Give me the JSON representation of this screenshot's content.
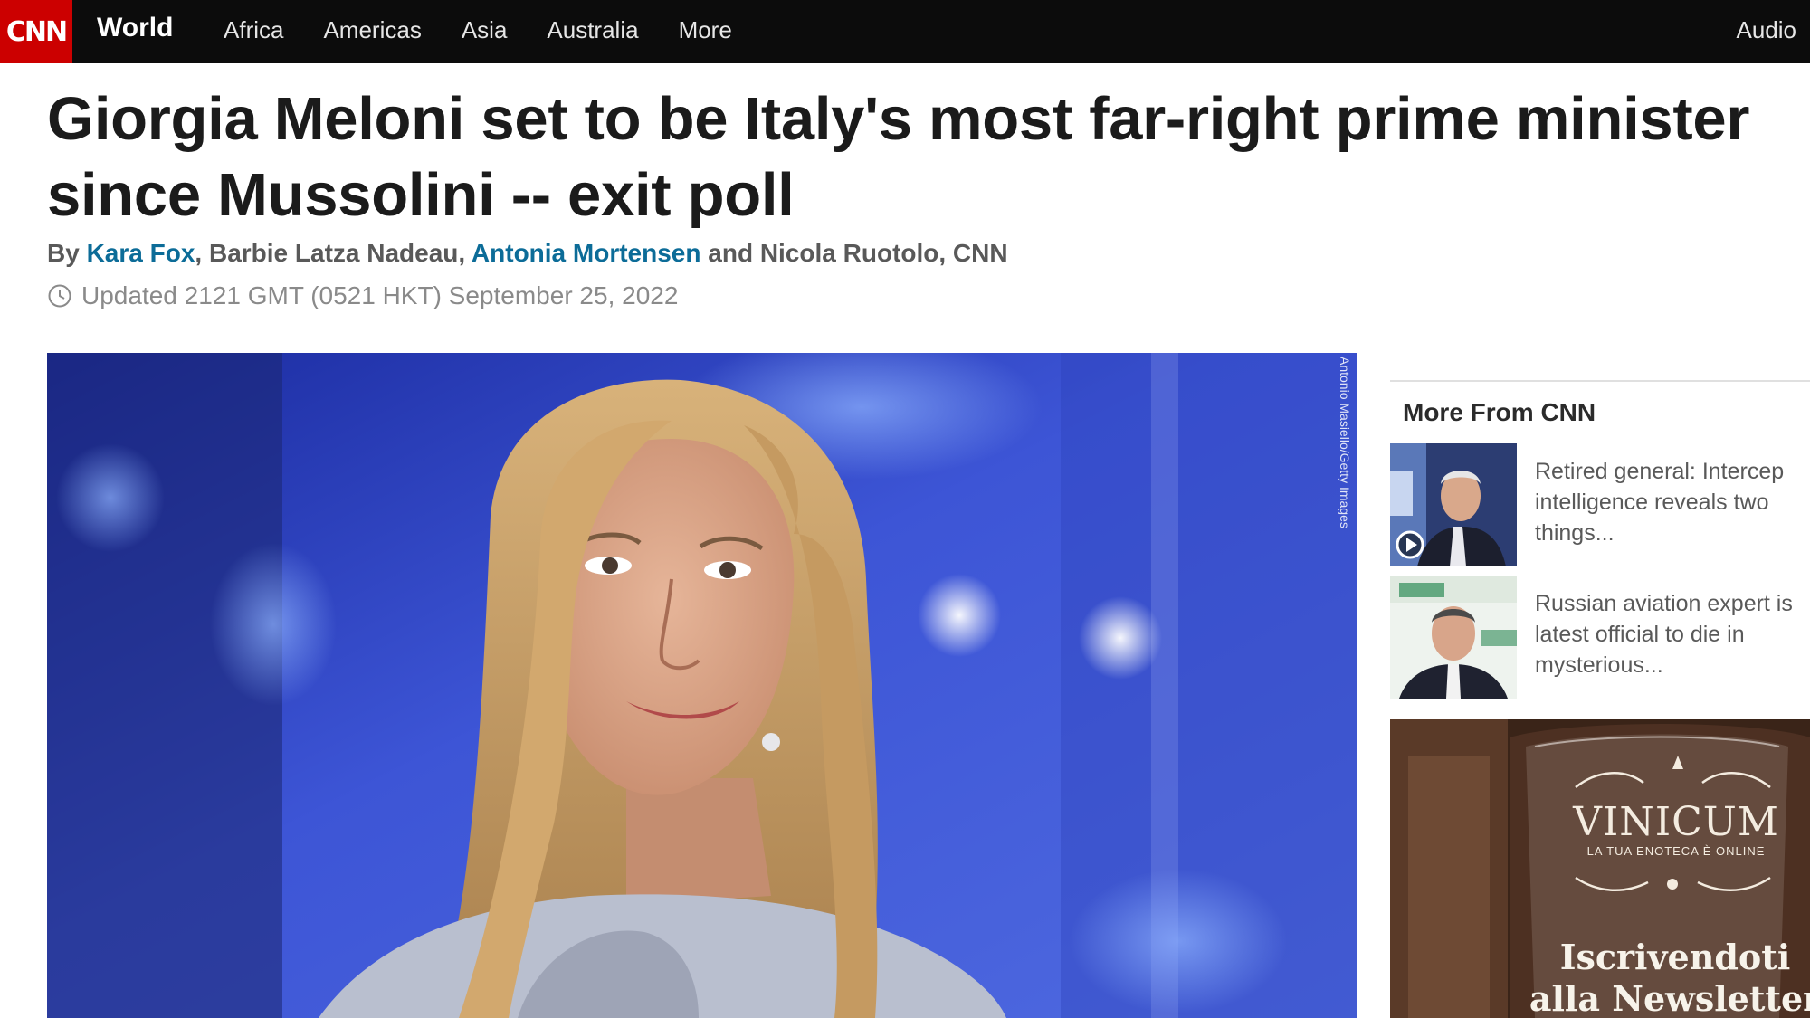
{
  "nav": {
    "logo": "CNN",
    "section": "World",
    "items": [
      "Africa",
      "Americas",
      "Asia",
      "Australia",
      "More"
    ],
    "audio": "Audio"
  },
  "article": {
    "headline": "Giorgia Meloni set to be Italy's most far-right prime minister since Mussolini -- exit poll",
    "byline": {
      "prefix": "By ",
      "authors": [
        "Kara Fox",
        "Barbie Latza Nadeau",
        "Antonia Mortensen",
        "Nicola Ruotolo"
      ],
      "sep1": ", ",
      "sep2": ", ",
      "and": " and ",
      "suffix": ", CNN"
    },
    "updated": "Updated 2121 GMT (0521 HKT) September 25, 2022",
    "photo_credit": "Antonio Masiello/Getty Images"
  },
  "rail": {
    "title": "More From CNN",
    "items": [
      {
        "lines": [
          "Retired general: Intercep",
          "intelligence reveals two",
          "things..."
        ],
        "has_video": true
      },
      {
        "lines": [
          "Russian aviation expert is",
          "latest official to die in",
          "mysterious..."
        ],
        "has_video": false
      }
    ]
  },
  "ad": {
    "brand": "VINICUM",
    "tagline": "LA TUA ENOTECA È ONLINE",
    "cta_lines": [
      "Iscrivendoti",
      "alla Newsletter"
    ]
  },
  "colors": {
    "nav_bg": "#0c0c0c",
    "logo_red": "#cc0000",
    "link_blue": "#0c6c98"
  },
  "icons": [
    "clock-icon",
    "play-icon"
  ]
}
